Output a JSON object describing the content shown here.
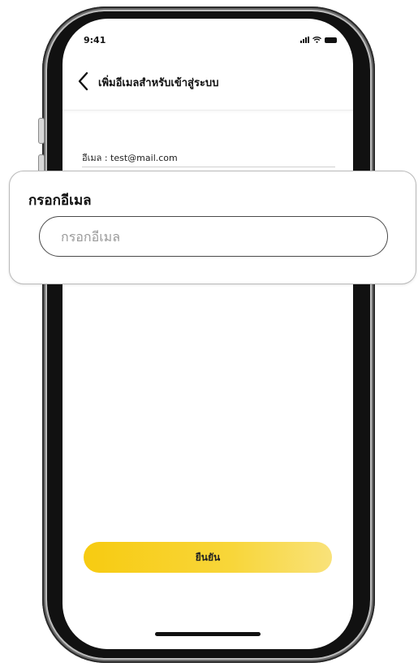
{
  "status_bar": {
    "time": "9:41",
    "icons": [
      "signal-icon",
      "wifi-icon",
      "battery-icon"
    ]
  },
  "nav": {
    "back_icon": "chevron-left-icon",
    "title": "เพิ่มอีเมลสำหรับเข้าสู่ระบบ"
  },
  "account": {
    "email_label": "อีเมล : test@mail.com"
  },
  "email_popup": {
    "title": "กรอกอีเมล",
    "input_value": "",
    "input_placeholder": "กรอกอีเมล"
  },
  "actions": {
    "confirm_label": "ยืนยัน"
  },
  "colors": {
    "accent_start": "#f7cb11",
    "accent_end": "#f9e27a",
    "text": "#111111"
  }
}
